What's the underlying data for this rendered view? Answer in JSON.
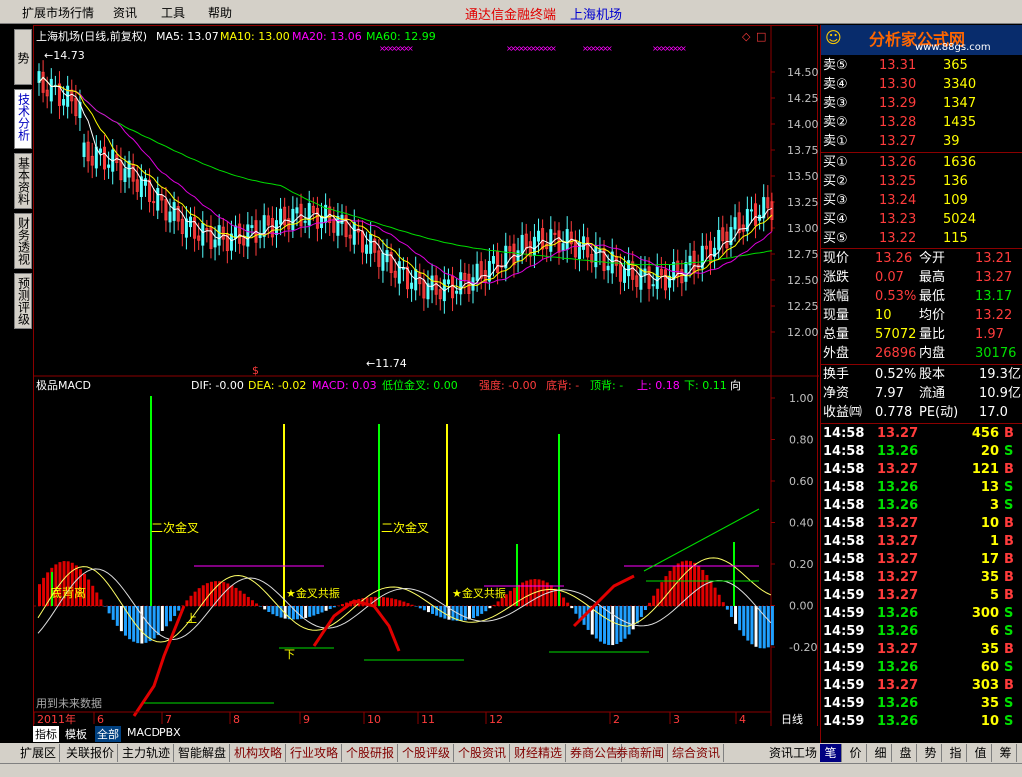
{
  "menubar": {
    "items": [
      "扩展市场行情",
      "资讯",
      "工具",
      "帮助"
    ],
    "terminal_name": "通达信金融终端",
    "stock_name": "上海机场"
  },
  "left_tabs": [
    "分时走势",
    "技术分析",
    "基本资料",
    "财务透视",
    "预测评级"
  ],
  "chart": {
    "header": {
      "title": "上海机场(日线,前复权)",
      "ma5": "MA5: 13.07",
      "ma10": "MA10: 13.00",
      "ma20": "MA20: 13.06",
      "ma60": "MA60: 12.99"
    },
    "price_axis": [
      "14.50",
      "14.25",
      "14.00",
      "13.75",
      "13.50",
      "13.25",
      "13.00",
      "12.75",
      "12.50",
      "12.25",
      "12.00"
    ],
    "high_label": "14.73",
    "low_label": "11.74",
    "dollar_mark": "$",
    "indicator_header": {
      "name": "极品MACD",
      "dif": "DIF: -0.00",
      "dea": "DEA: -0.02",
      "macd": "MACD: 0.03",
      "low_cross": "低位金叉: 0.00",
      "strength": "强度: -0.00",
      "bottom_div": "底背: -",
      "top_div": "顶背: -",
      "up": "上: 0.18",
      "down": "下: 0.11",
      "dir": "向"
    },
    "indicator_axis": [
      "1.00",
      "0.80",
      "0.60",
      "0.40",
      "0.20",
      "0.00",
      "-0.20"
    ],
    "annotations": {
      "second_cross_1": "二次金叉",
      "second_cross_2": "二次金叉",
      "bottom_div": "底背离",
      "gold_cross_1": "金叉共振",
      "gold_cross_2": "金叉共振",
      "shang": "上",
      "xia": "下"
    },
    "future_data": "用到未来数据",
    "time_axis": [
      "2011年",
      "6",
      "7",
      "8",
      "9",
      "10",
      "11",
      "12",
      "2",
      "3",
      "4"
    ],
    "period": "日线"
  },
  "bottom_tabs": [
    "指标",
    "模板",
    "全部",
    "MACD",
    "PBX"
  ],
  "info_tabs": [
    "扩展区",
    "关联报价",
    "主力轨迹",
    "智能解盘",
    "机构攻略",
    "行业攻略",
    "个股研报",
    "个股评级",
    "个股资讯",
    "财经精选",
    "券商公告",
    "券商新闻",
    "综合资讯",
    "资讯工场"
  ],
  "quote": {
    "logo_text": "分析家公式网",
    "logo_url": "www.88gs.com",
    "asks": [
      {
        "label": "卖⑤",
        "price": "13.31",
        "vol": "365"
      },
      {
        "label": "卖④",
        "price": "13.30",
        "vol": "3340"
      },
      {
        "label": "卖③",
        "price": "13.29",
        "vol": "1347"
      },
      {
        "label": "卖②",
        "price": "13.28",
        "vol": "1435"
      },
      {
        "label": "卖①",
        "price": "13.27",
        "vol": "39"
      }
    ],
    "bids": [
      {
        "label": "买①",
        "price": "13.26",
        "vol": "1636"
      },
      {
        "label": "买②",
        "price": "13.25",
        "vol": "136"
      },
      {
        "label": "买③",
        "price": "13.24",
        "vol": "109"
      },
      {
        "label": "买④",
        "price": "13.23",
        "vol": "5024"
      },
      {
        "label": "买⑤",
        "price": "13.22",
        "vol": "115"
      }
    ],
    "stats": [
      {
        "l1": "现价",
        "v1": "13.26",
        "l2": "今开",
        "v2": "13.21",
        "c1": "red",
        "c2": "red"
      },
      {
        "l1": "涨跌",
        "v1": "0.07",
        "l2": "最高",
        "v2": "13.27",
        "c1": "red",
        "c2": "red"
      },
      {
        "l1": "涨幅",
        "v1": "0.53%",
        "l2": "最低",
        "v2": "13.17",
        "c1": "red",
        "c2": "grn"
      },
      {
        "l1": "现量",
        "v1": "10",
        "l2": "均价",
        "v2": "13.22",
        "c1": "yel",
        "c2": "red"
      },
      {
        "l1": "总量",
        "v1": "57072",
        "l2": "量比",
        "v2": "1.97",
        "c1": "yel",
        "c2": "red"
      },
      {
        "l1": "外盘",
        "v1": "26896",
        "l2": "内盘",
        "v2": "30176",
        "c1": "red",
        "c2": "grn"
      }
    ],
    "fin": [
      {
        "l1": "换手",
        "v1": "0.52%",
        "l2": "股本",
        "v2": "19.3亿"
      },
      {
        "l1": "净资",
        "v1": "7.97",
        "l2": "流通",
        "v2": "10.9亿"
      },
      {
        "l1": "收益㈣",
        "v1": "0.778",
        "l2": "PE(动)",
        "v2": "17.0"
      }
    ],
    "ticks": [
      {
        "time": "14:58",
        "price": "13.27",
        "vol": "456",
        "bs": "B"
      },
      {
        "time": "14:58",
        "price": "13.26",
        "vol": "20",
        "bs": "S"
      },
      {
        "time": "14:58",
        "price": "13.27",
        "vol": "121",
        "bs": "B"
      },
      {
        "time": "14:58",
        "price": "13.26",
        "vol": "13",
        "bs": "S"
      },
      {
        "time": "14:58",
        "price": "13.26",
        "vol": "3",
        "bs": "S"
      },
      {
        "time": "14:58",
        "price": "13.27",
        "vol": "10",
        "bs": "B"
      },
      {
        "time": "14:58",
        "price": "13.27",
        "vol": "1",
        "bs": "B"
      },
      {
        "time": "14:58",
        "price": "13.27",
        "vol": "17",
        "bs": "B"
      },
      {
        "time": "14:58",
        "price": "13.27",
        "vol": "35",
        "bs": "B"
      },
      {
        "time": "14:59",
        "price": "13.27",
        "vol": "5",
        "bs": "B"
      },
      {
        "time": "14:59",
        "price": "13.26",
        "vol": "300",
        "bs": "S"
      },
      {
        "time": "14:59",
        "price": "13.26",
        "vol": "6",
        "bs": "S"
      },
      {
        "time": "14:59",
        "price": "13.27",
        "vol": "35",
        "bs": "B"
      },
      {
        "time": "14:59",
        "price": "13.26",
        "vol": "60",
        "bs": "S"
      },
      {
        "time": "14:59",
        "price": "13.27",
        "vol": "303",
        "bs": "B"
      },
      {
        "time": "14:59",
        "price": "13.26",
        "vol": "35",
        "bs": "S"
      },
      {
        "time": "14:59",
        "price": "13.26",
        "vol": "10",
        "bs": "S"
      }
    ],
    "tabs": [
      "笔",
      "价",
      "细",
      "盘",
      "势",
      "指",
      "值",
      "筹"
    ]
  },
  "colors": {
    "up": "#ff3c3c",
    "down": "#00e000",
    "frame": "#8b0000",
    "ma5": "#ffffff",
    "ma10": "#ffff00",
    "ma20": "#ff00ff",
    "ma60": "#00ff00"
  }
}
